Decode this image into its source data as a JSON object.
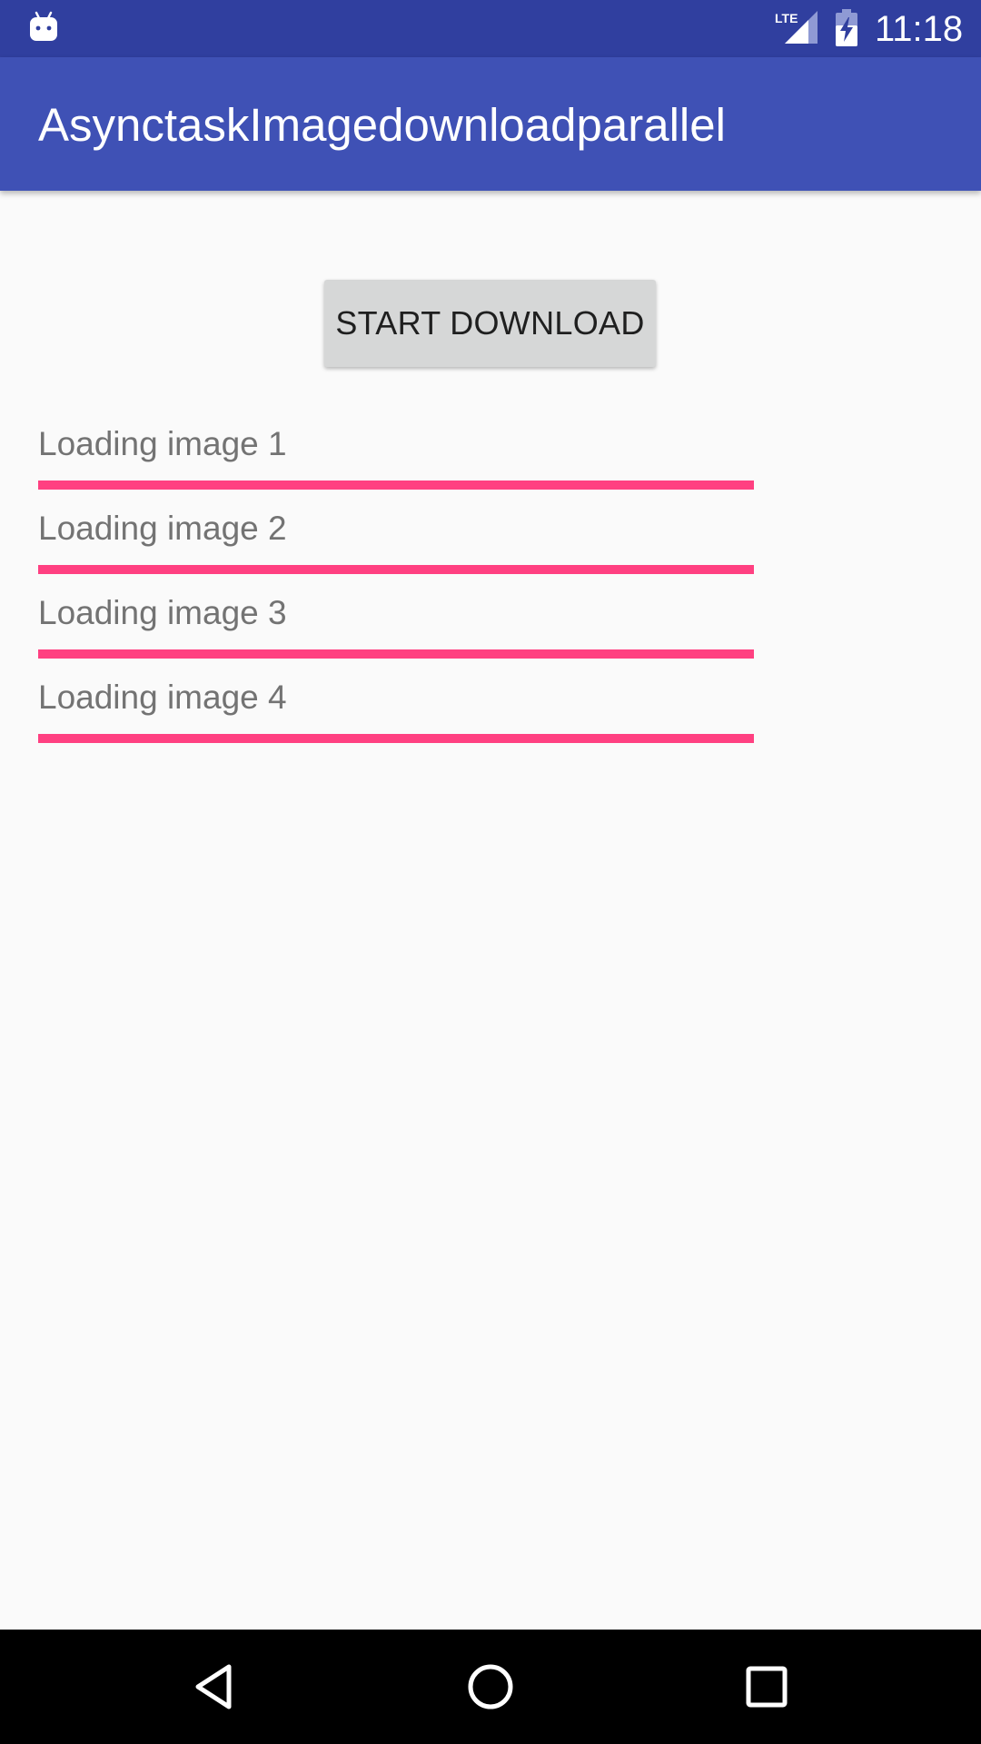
{
  "status_bar": {
    "time": "11:18",
    "network": "LTE",
    "icons": [
      "android-icon",
      "lte-signal-icon",
      "battery-charging-icon"
    ],
    "color": "#303f9f"
  },
  "app_bar": {
    "title": "AsynctaskImagedownloadparallel",
    "color": "#3f51b5"
  },
  "main": {
    "button_label": "START DOWNLOAD",
    "button_color": "#d6d7d7",
    "accent_color": "#ff4081",
    "rows": [
      {
        "label": "Loading image 1",
        "progress": 1.0
      },
      {
        "label": "Loading image 2",
        "progress": 1.0
      },
      {
        "label": "Loading image 3",
        "progress": 1.0
      },
      {
        "label": "Loading image 4",
        "progress": 1.0
      }
    ]
  },
  "nav_bar": {
    "buttons": [
      "back-icon",
      "home-icon",
      "recents-icon"
    ]
  }
}
